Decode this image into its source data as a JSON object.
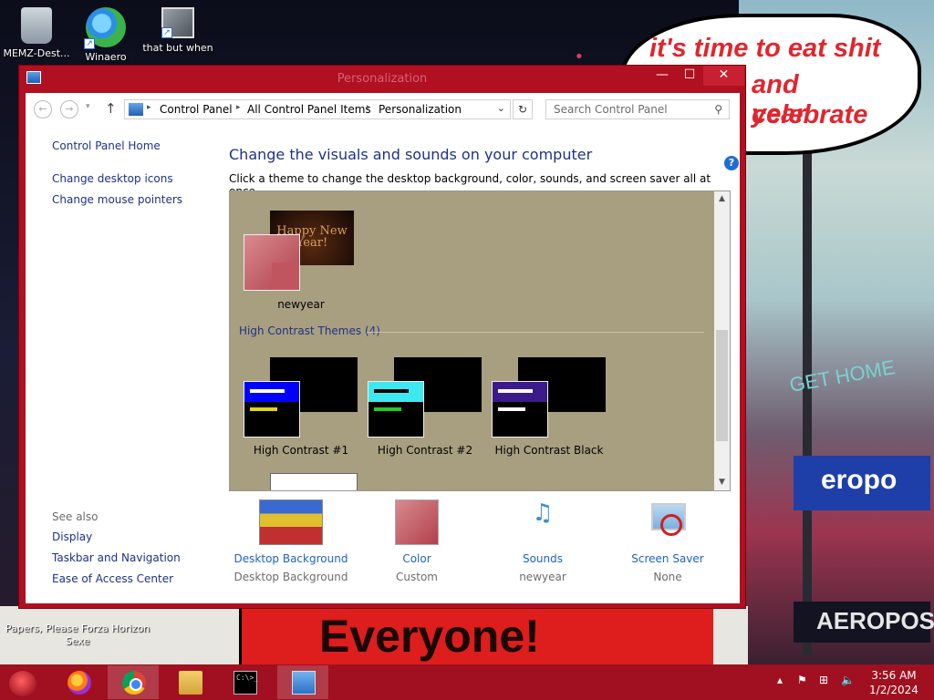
{
  "desktop": {
    "icons": [
      {
        "label": "MEMZ-Dest..."
      },
      {
        "label": "Winaero"
      },
      {
        "label": "that but when"
      }
    ],
    "bottom_icon_label": "Papers, Please Forza Horizon Sexe",
    "bubble_lines": [
      "it's time to eat shit",
      "and celebrate",
      "year"
    ],
    "wallpaper_text": "Everyone!",
    "sign_text_1": "eropo",
    "sign_text_2": "AEROPOS",
    "sign_text_3": "GET HOME"
  },
  "window": {
    "title": "Personalization",
    "close_glyph": "✕",
    "min_glyph": "—",
    "max_glyph": "☐"
  },
  "navbar": {
    "back_glyph": "←",
    "forward_glyph": "→",
    "recent_glyph": "▾",
    "up_glyph": "↑",
    "breadcrumbs": [
      "Control Panel",
      "All Control Panel Items",
      "Personalization"
    ],
    "sep_glyph": "▸",
    "dropdown_glyph": "⌄",
    "refresh_glyph": "↻",
    "search_placeholder": "Search Control Panel",
    "search_glyph": "⚲"
  },
  "left_pane": {
    "home": "Control Panel Home",
    "links": [
      "Change desktop icons",
      "Change mouse pointers"
    ],
    "see_also_header": "See also",
    "see_also": [
      "Display",
      "Taskbar and Navigation",
      "Ease of Access Center"
    ]
  },
  "main": {
    "help_glyph": "?",
    "heading": "Change the visuals and sounds on your computer",
    "subheading": "Click a theme to change the desktop background, color, sounds, and screen saver all at once.",
    "my_theme": {
      "name": "newyear",
      "preview_text": "Happy New Year!"
    },
    "high_contrast_header": "High Contrast Themes (4)",
    "high_contrast": [
      {
        "name": "High Contrast #1",
        "bar_color": "#0000ff",
        "line_color": "#e5d31a"
      },
      {
        "name": "High Contrast #2",
        "bar_color": "#3ee8f0",
        "line_color": "#1ecf1e"
      },
      {
        "name": "High Contrast Black",
        "bar_color": "#3b1a8a",
        "line_color": "#ffffff"
      }
    ],
    "scroll_up": "▲",
    "scroll_down": "▼"
  },
  "settings": [
    {
      "label": "Desktop Background",
      "value": "Desktop Background"
    },
    {
      "label": "Color",
      "value": "Custom"
    },
    {
      "label": "Sounds",
      "value": "newyear",
      "icon_glyph": "♫"
    },
    {
      "label": "Screen Saver",
      "value": "None"
    }
  ],
  "taskbar": {
    "cmd_text": "C:\\>_",
    "tray_icons": {
      "chevron": "▴",
      "flag": "⚑",
      "network": "⊞",
      "volume": "🔈"
    },
    "time": "3:56 AM",
    "date": "1/2/2024"
  }
}
